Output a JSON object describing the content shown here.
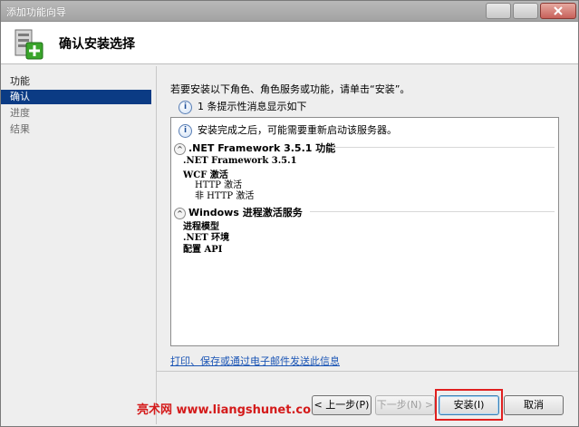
{
  "window": {
    "title": "添加功能向导"
  },
  "header": {
    "title": "确认安装选择"
  },
  "sidebar": {
    "items": [
      {
        "label": "功能"
      },
      {
        "label": "确认"
      },
      {
        "label": "进度"
      },
      {
        "label": "结果"
      }
    ]
  },
  "main": {
    "intro": "若要安装以下角色、角色服务或功能，请单击“安装”。",
    "info_message": "1 条提示性消息显示如下",
    "restart_note": "安装完成之后，可能需要重新启动该服务器。",
    "sections": [
      {
        "title": ".NET Framework 3.5.1 功能",
        "items": [
          {
            "label": ".NET Framework 3.5.1"
          },
          {
            "label": "WCF 激活"
          },
          {
            "label": "HTTP 激活"
          },
          {
            "label": "非 HTTP 激活"
          }
        ]
      },
      {
        "title": "Windows 进程激活服务",
        "items": [
          {
            "label": "进程模型"
          },
          {
            "label": ".NET 环境"
          },
          {
            "label": "配置 API"
          }
        ]
      }
    ],
    "print_link": "打印、保存或通过电子邮件发送此信息"
  },
  "watermark": "亮术网 www.liangshunet.com",
  "buttons": {
    "previous": "< 上一步(P)",
    "next": "下一步(N) >",
    "install": "安装(I)",
    "cancel": "取消"
  }
}
